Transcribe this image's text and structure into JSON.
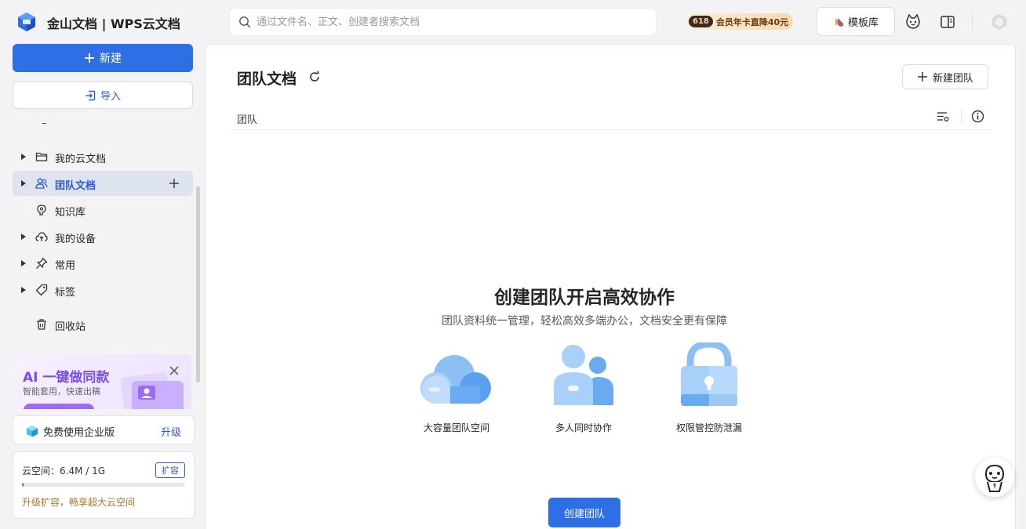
{
  "header": {
    "app_title": "金山文档 | WPS云文档",
    "search_placeholder": "通过文件名、正文、创建者搜索文档",
    "promo_badge": "618",
    "promo_text": "会员年卡直降40元",
    "template_button": "模板库"
  },
  "sidebar": {
    "new_button": "新建",
    "import_button": "导入",
    "items": [
      {
        "label": "我的云文档",
        "icon": "folder-icon",
        "has_caret": true,
        "active": false
      },
      {
        "label": "团队文档",
        "icon": "team-icon",
        "has_caret": true,
        "active": true
      },
      {
        "label": "知识库",
        "icon": "knowledge-icon",
        "has_caret": false,
        "active": false
      },
      {
        "label": "我的设备",
        "icon": "cloud-device-icon",
        "has_caret": true,
        "active": false
      },
      {
        "label": "常用",
        "icon": "pin-icon",
        "has_caret": true,
        "active": false
      },
      {
        "label": "标签",
        "icon": "tag-icon",
        "has_caret": true,
        "active": false
      },
      {
        "label": "回收站",
        "icon": "trash-icon",
        "has_caret": false,
        "active": false
      }
    ],
    "ai_card": {
      "title": "AI 一键做同款",
      "subtitle": "智能套用，快速出稿"
    },
    "enterprise": {
      "label": "免费使用企业版",
      "upgrade": "升级"
    },
    "storage": {
      "label": "云空间：6.4M / 1G",
      "expand": "扩容",
      "tip": "升级扩容，畅享超大云空间",
      "used_fraction": 0.0064
    }
  },
  "main": {
    "title": "团队文档",
    "new_team_button": "新建团队",
    "column_team": "团队",
    "empty_title": "创建团队开启高效协作",
    "empty_subtitle": "团队资料统一管理，轻松高效多端办公，文档安全更有保障",
    "features": [
      {
        "label": "大容量团队空间",
        "icon": "cloud-storage-icon"
      },
      {
        "label": "多人同时协作",
        "icon": "collaboration-icon"
      },
      {
        "label": "权限管控防泄漏",
        "icon": "lock-icon"
      }
    ],
    "create_team_button": "创建团队"
  },
  "colors": {
    "accent": "#2f6fe5",
    "active_bg": "#dde4f0",
    "ai_purple": "#7a4df0",
    "warning": "#b5722a"
  }
}
